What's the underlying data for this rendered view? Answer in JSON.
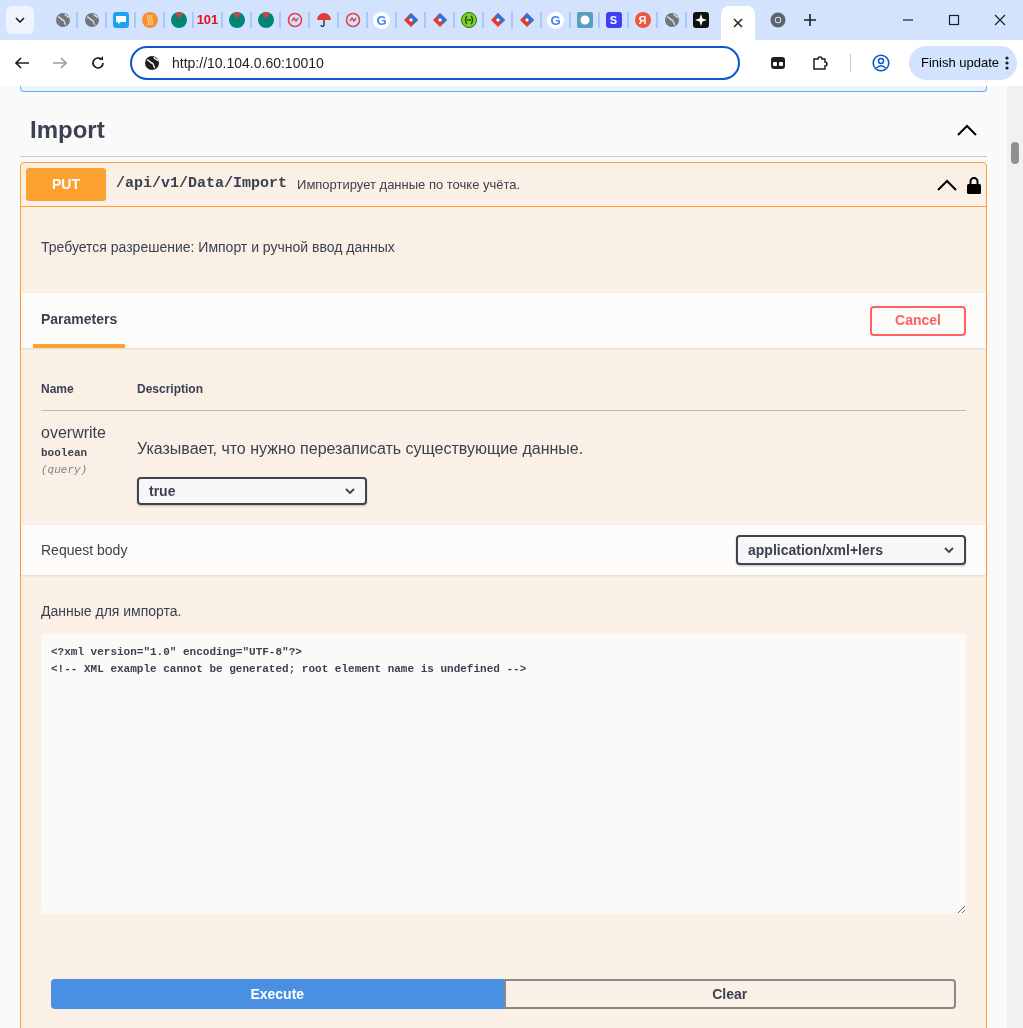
{
  "browser": {
    "tabs": [
      {
        "kind": "globe",
        "selected": false
      },
      {
        "kind": "globe",
        "selected": false
      },
      {
        "kind": "mail",
        "selected": false
      },
      {
        "kind": "orange",
        "selected": false
      },
      {
        "kind": "v",
        "selected": false
      },
      {
        "kind": "glyph",
        "glyph": "101",
        "selected": false
      },
      {
        "kind": "v",
        "selected": false
      },
      {
        "kind": "v",
        "selected": false
      },
      {
        "kind": "ring",
        "selected": false
      },
      {
        "kind": "umbrella",
        "selected": false
      },
      {
        "kind": "ring",
        "selected": false
      },
      {
        "kind": "google",
        "glyph": "G",
        "selected": false
      },
      {
        "kind": "diamond",
        "selected": false
      },
      {
        "kind": "diamond",
        "selected": false
      },
      {
        "kind": "green",
        "selected": false
      },
      {
        "kind": "diamond",
        "selected": false
      },
      {
        "kind": "diamond",
        "selected": false
      },
      {
        "kind": "google",
        "glyph": "G",
        "selected": false
      },
      {
        "kind": "splash",
        "selected": false
      },
      {
        "kind": "letter",
        "glyph": "S",
        "selected": false
      },
      {
        "kind": "round",
        "glyph": "Я",
        "selected": false
      },
      {
        "kind": "globe",
        "selected": false
      },
      {
        "kind": "star",
        "selected": false
      },
      {
        "kind": "blank",
        "selected": true
      },
      {
        "kind": "chrome",
        "selected": false
      }
    ],
    "url": "http://10.104.0.60:10010",
    "update_button": "Finish update"
  },
  "section": {
    "title": "Import",
    "expanded": true
  },
  "operation": {
    "method": "PUT",
    "path": "/api/v1/Data/Import",
    "summary": "Импортирует данные по точке учёта.",
    "expanded": true,
    "locked": true,
    "auth_note": "Требуется разрешение: Импорт и ручной ввод данных",
    "parameters_tab": "Parameters",
    "cancel_button": "Cancel",
    "columns": [
      "Name",
      "Description"
    ],
    "params": [
      {
        "name": "overwrite",
        "type": "boolean",
        "in": "(query)",
        "description": "Указывает, что нужно перезаписать существующие данные.",
        "value": "true"
      }
    ],
    "request_body": {
      "label": "Request body",
      "content_type": "application/xml+lers",
      "description": "Данные для импорта.",
      "code": "<?xml version=\"1.0\" encoding=\"UTF-8\"?>\n<!-- XML example cannot be generated; root element name is undefined -->"
    },
    "buttons": [
      {
        "label": "Execute",
        "kind": "primary"
      },
      {
        "label": "Clear",
        "kind": "secondary"
      }
    ]
  }
}
